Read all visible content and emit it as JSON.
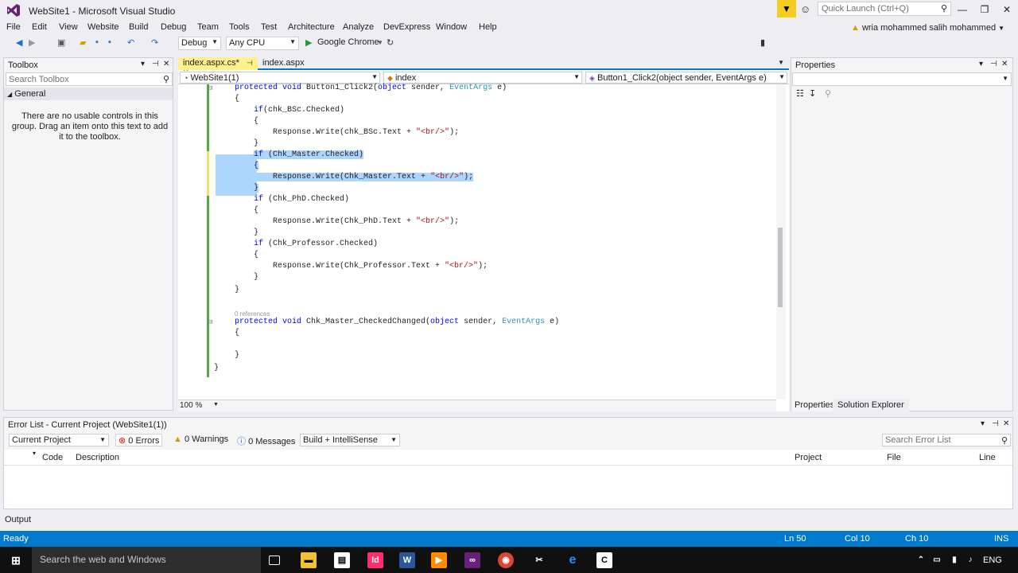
{
  "window": {
    "title": "WebSite1 - Microsoft Visual Studio"
  },
  "quick_launch": {
    "placeholder": "Quick Launch (Ctrl+Q)"
  },
  "user": {
    "name": "wria mohammed salih mohammed"
  },
  "menu": [
    "File",
    "Edit",
    "View",
    "Website",
    "Build",
    "Debug",
    "Team",
    "Tools",
    "Test",
    "Architecture",
    "Analyze",
    "DevExpress",
    "Window",
    "Help"
  ],
  "toolbar": {
    "config": "Debug",
    "platform": "Any CPU",
    "browser": "Google Chrome"
  },
  "toolbox": {
    "title": "Toolbox",
    "search_placeholder": "Search Toolbox",
    "group": "General",
    "empty_text": "There are no usable controls in this group. Drag an item onto this text to add it to the toolbox."
  },
  "editor": {
    "tabs": [
      {
        "label": "index.aspx.cs*",
        "active": true
      },
      {
        "label": "index.aspx",
        "active": false
      }
    ],
    "nav": {
      "project": "WebSite1(1)",
      "class": "index",
      "member": "Button1_Click2(object sender, EventArgs e)"
    },
    "zoom": "100 %",
    "code": [
      [
        "",
        "protected void Button1_Click2(object sender, EventArgs e)"
      ],
      [
        "",
        "{"
      ],
      [
        "",
        "    if(chk_BSc.Checked)"
      ],
      [
        "",
        "    {"
      ],
      [
        "",
        "        Response.Write(chk_BSc.Text + \"<br/>\");"
      ],
      [
        "",
        "    }"
      ],
      [
        "sel",
        "    if (Chk_Master.Checked)"
      ],
      [
        "sel",
        "    {"
      ],
      [
        "sel",
        "        Response.Write(Chk_Master.Text + \"<br/>\");"
      ],
      [
        "sel",
        "    }"
      ],
      [
        "",
        "    if (Chk_PhD.Checked)"
      ],
      [
        "",
        "    {"
      ],
      [
        "",
        "        Response.Write(Chk_PhD.Text + \"<br/>\");"
      ],
      [
        "",
        "    }"
      ],
      [
        "",
        "    if (Chk_Professor.Checked)"
      ],
      [
        "",
        "    {"
      ],
      [
        "",
        "        Response.Write(Chk_Professor.Text + \"<br/>\");"
      ],
      [
        "",
        "    }"
      ],
      [
        "",
        "}"
      ],
      [
        "",
        "0 references"
      ],
      [
        "",
        "protected void Chk_Master_CheckedChanged(object sender, EventArgs e)"
      ],
      [
        "",
        "{"
      ],
      [
        "",
        ""
      ],
      [
        "",
        "}"
      ],
      [
        "",
        "}"
      ]
    ]
  },
  "properties": {
    "title": "Properties",
    "tabs": [
      "Properties",
      "Solution Explorer"
    ]
  },
  "error_list": {
    "title": "Error List - Current Project (WebSite1(1))",
    "scope": "Current Project",
    "errors": "0 Errors",
    "warnings": "0 Warnings",
    "messages": "0 Messages",
    "build_filter": "Build + IntelliSense",
    "search_placeholder": "Search Error List",
    "columns": {
      "code": "Code",
      "description": "Description",
      "project": "Project",
      "file": "File",
      "line": "Line"
    }
  },
  "output_tab": "Output",
  "status": {
    "ready": "Ready",
    "ln": "Ln 50",
    "col": "Col 10",
    "ch": "Ch 10",
    "ins": "INS"
  },
  "taskbar": {
    "search": "Search the web and Windows",
    "lang": "ENG"
  }
}
